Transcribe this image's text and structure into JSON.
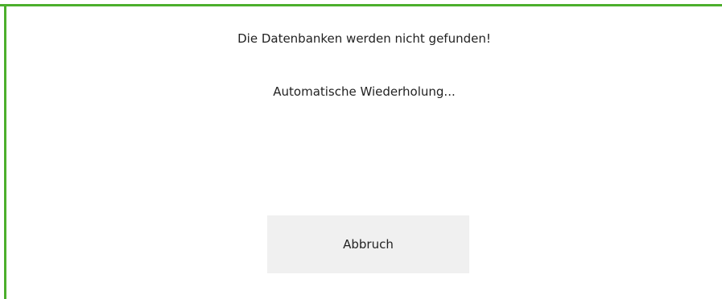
{
  "dialog": {
    "message": "Die Datenbanken werden nicht gefunden!",
    "status": "Automatische Wiederholung...",
    "cancel_label": "Abbruch"
  },
  "colors": {
    "accent_border": "#4caf2c",
    "button_bg": "#f0f0f0",
    "text": "#222222"
  }
}
